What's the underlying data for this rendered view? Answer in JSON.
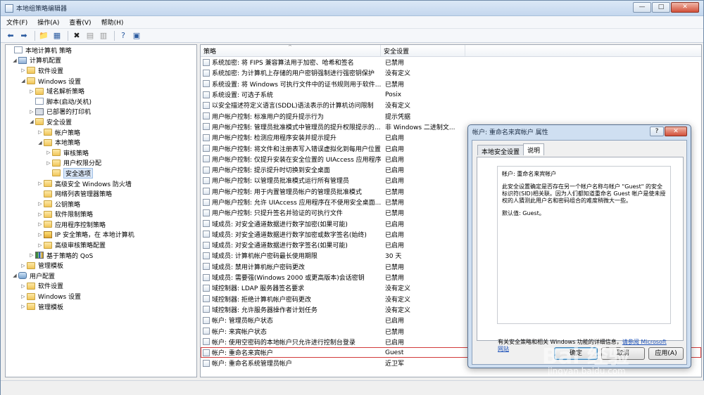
{
  "window": {
    "title": "本地组策略编辑器",
    "min_glyph": "—",
    "max_glyph": "□",
    "close_glyph": "✕"
  },
  "menu": [
    "文件(F)",
    "操作(A)",
    "查看(V)",
    "帮助(H)"
  ],
  "toolbar": {
    "icons": [
      "back-arrow-icon",
      "forward-arrow-icon",
      "up-folder-icon",
      "show-hide-tree-icon",
      "delete-icon",
      "properties-icon",
      "export-list-icon",
      "help-icon",
      "extended-view-icon"
    ]
  },
  "tree": [
    {
      "label": "本地计算机 策略",
      "icon": "doc"
    },
    {
      "label": "计算机配置",
      "icon": "pc"
    },
    {
      "label": "软件设置",
      "icon": "folder"
    },
    {
      "label": "Windows 设置",
      "icon": "folder"
    },
    {
      "label": "域名解析策略",
      "icon": "folder"
    },
    {
      "label": "脚本(启动/关机)",
      "icon": "doc"
    },
    {
      "label": "已部署的打印机",
      "icon": "printer"
    },
    {
      "label": "安全设置",
      "icon": "folder"
    },
    {
      "label": "帐户策略",
      "icon": "folder"
    },
    {
      "label": "本地策略",
      "icon": "folder"
    },
    {
      "label": "审核策略",
      "icon": "folder"
    },
    {
      "label": "用户权限分配",
      "icon": "folder"
    },
    {
      "label": "安全选项",
      "icon": "folder"
    },
    {
      "label": "高级安全 Windows 防火墙",
      "icon": "folder"
    },
    {
      "label": "网络列表管理器策略",
      "icon": "folder"
    },
    {
      "label": "公钥策略",
      "icon": "folder"
    },
    {
      "label": "软件限制策略",
      "icon": "folder"
    },
    {
      "label": "应用程序控制策略",
      "icon": "folder"
    },
    {
      "label": "IP 安全策略，在 本地计算机",
      "icon": "net"
    },
    {
      "label": "高级审核策略配置",
      "icon": "folder"
    },
    {
      "label": "基于策略的 QoS",
      "icon": "chart"
    },
    {
      "label": "管理模板",
      "icon": "folder"
    },
    {
      "label": "用户配置",
      "icon": "user"
    },
    {
      "label": "软件设置",
      "icon": "folder"
    },
    {
      "label": "Windows 设置",
      "icon": "folder"
    },
    {
      "label": "管理模板",
      "icon": "folder"
    }
  ],
  "list": {
    "col_policy": "策略",
    "col_setting": "安全设置",
    "sort_glyph": "^",
    "rows": [
      {
        "policy": "系统加密: 将 FIPS 兼容算法用于加密、哈希和签名",
        "setting": "已禁用"
      },
      {
        "policy": "系统加密: 为计算机上存储的用户密钥强制进行强密钥保护",
        "setting": "没有定义"
      },
      {
        "policy": "系统设置: 将 Windows 可执行文件中的证书规则用于软件...",
        "setting": "已禁用"
      },
      {
        "policy": "系统设置: 可选子系统",
        "setting": "Posix"
      },
      {
        "policy": "以安全描述符定义语言(SDDL)语法表示的计算机访问限制",
        "setting": "没有定义"
      },
      {
        "policy": "用户帐户控制: 标准用户的提升提示行为",
        "setting": "提示凭据"
      },
      {
        "policy": "用户帐户控制: 管理员批准模式中管理员的提升权限提示的...",
        "setting": "非 Windows 二进制文..."
      },
      {
        "policy": "用户帐户控制: 检测应用程序安装并提示提升",
        "setting": "已启用"
      },
      {
        "policy": "用户帐户控制: 将文件和注册表写入错误虚拟化到每用户位置",
        "setting": "已启用"
      },
      {
        "policy": "用户帐户控制: 仅提升安装在安全位置的 UIAccess 应用程序",
        "setting": "已启用"
      },
      {
        "policy": "用户帐户控制: 提示提升时切换到安全桌面",
        "setting": "已启用"
      },
      {
        "policy": "用户帐户控制: 以管理员批准模式运行所有管理员",
        "setting": "已启用"
      },
      {
        "policy": "用户帐户控制: 用于内置管理员帐户的管理员批准模式",
        "setting": "已禁用"
      },
      {
        "policy": "用户帐户控制: 允许 UIAccess 应用程序在不使用安全桌面...",
        "setting": "已禁用"
      },
      {
        "policy": "用户帐户控制: 只提升签名并验证的可执行文件",
        "setting": "已禁用"
      },
      {
        "policy": "域成员: 对安全通道数据进行数字加密(如果可能)",
        "setting": "已启用"
      },
      {
        "policy": "域成员: 对安全通道数据进行数字加密或数字签名(始终)",
        "setting": "已启用"
      },
      {
        "policy": "域成员: 对安全通道数据进行数字签名(如果可能)",
        "setting": "已启用"
      },
      {
        "policy": "域成员: 计算机帐户密码最长使用期限",
        "setting": "30 天"
      },
      {
        "policy": "域成员: 禁用计算机帐户密码更改",
        "setting": "已禁用"
      },
      {
        "policy": "域成员: 需要强(Windows 2000 或更高版本)会话密钥",
        "setting": "已禁用"
      },
      {
        "policy": "域控制器: LDAP 服务器签名要求",
        "setting": "没有定义"
      },
      {
        "policy": "域控制器: 拒绝计算机帐户密码更改",
        "setting": "没有定义"
      },
      {
        "policy": "域控制器: 允许服务器操作者计划任务",
        "setting": "没有定义"
      },
      {
        "policy": "帐户: 管理员帐户状态",
        "setting": "已启用"
      },
      {
        "policy": "帐户: 来宾帐户状态",
        "setting": "已禁用"
      },
      {
        "policy": "帐户: 使用空密码的本地帐户只允许进行控制台登录",
        "setting": "已启用"
      },
      {
        "policy": "帐户: 重命名来宾帐户",
        "setting": "Guest"
      },
      {
        "policy": "帐户: 重命名系统管理员帐户",
        "setting": "近卫军"
      }
    ]
  },
  "dialog": {
    "title": "帐户: 重命名来宾帐户 属性",
    "help_glyph": "?",
    "close_glyph": "✕",
    "tabs": [
      "本地安全设置",
      "说明"
    ],
    "explain_title": "帐户: 重命名来宾帐户",
    "explain_body": "此安全设置确定是否存在另一个帐户名称与帐户 \"Guest\" 的安全标识符(SID)相关联。因为人们都知道重命名 Guest 帐户是使未授权的人猜测此用户名和密码组合的难度稍微大一些。",
    "explain_default": "默认值: Guest。",
    "more_text": "有关安全策略和相关 Windows 功能的详细信息，",
    "more_link": "请参阅 Microsoft 网站",
    "buttons": [
      "确定",
      "取消",
      "应用(A)"
    ]
  },
  "watermark": {
    "brand": "Bai  经验",
    "url": "jingyan.baidu.com"
  }
}
